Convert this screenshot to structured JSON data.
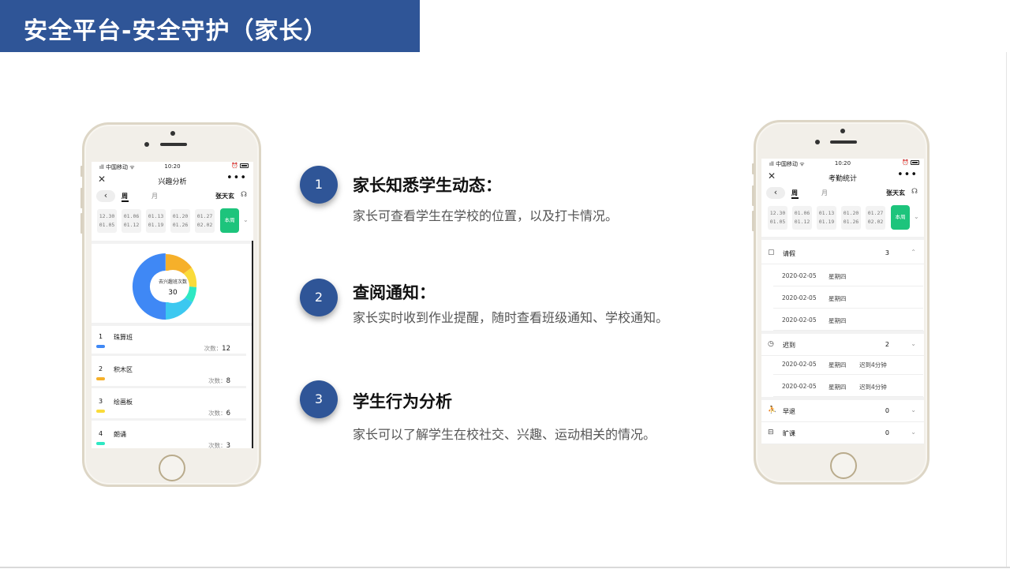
{
  "slide": {
    "title": "安全平台-安全守护（家长）"
  },
  "features": [
    {
      "number": "1",
      "title": "家长知悉学生动态：",
      "desc": "家长可查看学生在学校的位置，以及打卡情况。"
    },
    {
      "number": "2",
      "title": "查阅通知：",
      "desc": "家长实时收到作业提醒，随时查看班级通知、学校通知。"
    },
    {
      "number": "3",
      "title": "学生行为分析",
      "desc": "家长可以了解学生在校社交、兴趣、运动相关的情况。"
    }
  ],
  "phone_common": {
    "carrier": "中国移动",
    "time": "10:20",
    "more": "•••",
    "close": "✕",
    "back": "‹",
    "tab_week": "周",
    "tab_month": "月",
    "student_name": "张天玄",
    "week_button": "本周",
    "dates": [
      {
        "start": "12.30",
        "end": "01.05"
      },
      {
        "start": "01.06",
        "end": "01.12"
      },
      {
        "start": "01.13",
        "end": "01.19"
      },
      {
        "start": "01.20",
        "end": "01.26"
      },
      {
        "start": "01.27",
        "end": "02.02"
      }
    ]
  },
  "left_phone": {
    "page_title": "兴趣分析",
    "donut_label": "去兴趣班次数",
    "donut_value": "30",
    "count_prefix": "次数：",
    "colors": {
      "blue": "#3f88f5",
      "orange": "#f6b02a",
      "yellow": "#fadb3a",
      "teal": "#2ee8c3",
      "cyan": "#3cc8f0"
    },
    "items": [
      {
        "num": "1",
        "name": "珠算班",
        "count": "12",
        "color": "#3f88f5"
      },
      {
        "num": "2",
        "name": "积木区",
        "count": "8",
        "color": "#f6b02a"
      },
      {
        "num": "3",
        "name": "绘画板",
        "count": "6",
        "color": "#fadb3a"
      },
      {
        "num": "4",
        "name": "朗诵",
        "count": "3",
        "color": "#2ee8c3"
      }
    ]
  },
  "right_phone": {
    "page_title": "考勤统计",
    "leave": {
      "label": "请假",
      "value": "3",
      "records": [
        {
          "date": "2020-02-05",
          "weekday": "星期四"
        },
        {
          "date": "2020-02-05",
          "weekday": "星期四"
        },
        {
          "date": "2020-02-05",
          "weekday": "星期四"
        }
      ]
    },
    "late": {
      "label": "迟到",
      "value": "2",
      "records": [
        {
          "date": "2020-02-05",
          "weekday": "星期四",
          "note": "迟到4分钟"
        },
        {
          "date": "2020-02-05",
          "weekday": "星期四",
          "note": "迟到4分钟"
        }
      ]
    },
    "early": {
      "label": "早退",
      "value": "0"
    },
    "absent": {
      "label": "旷课",
      "value": "0"
    }
  }
}
